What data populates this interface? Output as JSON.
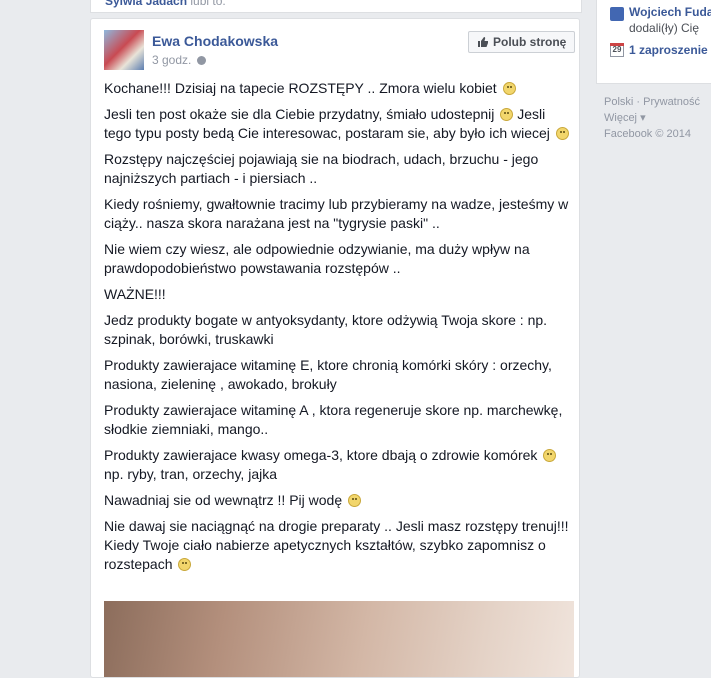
{
  "top_story": {
    "name": "Sylwia Jadach",
    "suffix": "lubi to."
  },
  "post": {
    "author": "Ewa Chodakowska",
    "time": "3 godz.",
    "like_button": "Polub stronę",
    "paragraphs": [
      "Kochane!!! Dzisiaj na tapecie ROZSTĘPY .. Zmora wielu kobiet",
      "Jesli ten post okaże sie dla Ciebie przydatny, śmiało udostepnij",
      "Jesli tego typu posty bedą Cie interesowac, postaram sie, aby było ich wiecej",
      "Rozstępy najczęściej pojawiają sie na biodrach, udach, brzuchu - jego najniższych partiach - i piersiach ..",
      "Kiedy rośniemy, gwałtownie tracimy lub przybieramy na wadze, jesteśmy w ciąży.. nasza skora narażana jest na \"tygrysie paski\" ..",
      "Nie wiem czy wiesz, ale odpowiednie odzywianie, ma duży wpływ na prawdopodobieństwo powstawania rozstępów ..",
      "WAŻNE!!!",
      "Jedz produkty bogate w antyoksydanty, ktore odżywią Twoja skore : np. szpinak, borówki, truskawki",
      "Produkty zawierajace witaminę E, ktore chronią komórki skóry : orzechy, nasiona, zieleninę , awokado, brokuły",
      "Produkty zawierajace witaminę A , ktora regeneruje skore np. marchewkę, słodkie ziemniaki, mango..",
      "Produkty zawierajace kwasy omega-3, ktore dbają o zdrowie komórek",
      "np. ryby, tran, orzechy, jajka",
      "Nawadniaj sie od wewnątrz !! Pij wodę",
      "Nie dawaj sie naciągnąć na drogie preparaty .. Jesli masz rozstępy trenuj!!! Kiedy Twoje ciało nabierze apetycznych kształtów, szybko zapomnisz o rozstepach"
    ]
  },
  "rail": {
    "friend_name": "Wojciech Fuda",
    "friend_sub": "dodali(ły) Cię",
    "calendar_day": "29",
    "invite": "1 zaproszenie",
    "footer_lang": "Polski",
    "footer_privacy": "Prywatność",
    "footer_more": "Więcej",
    "copyright": "Facebook © 2014"
  },
  "icons": [
    "like-thumb-icon",
    "globe-icon",
    "smiley-icon",
    "facebook-icon",
    "calendar-icon"
  ],
  "colors": {
    "link": "#3b5998",
    "meta": "#9197a3",
    "background": "#e9ebee"
  }
}
